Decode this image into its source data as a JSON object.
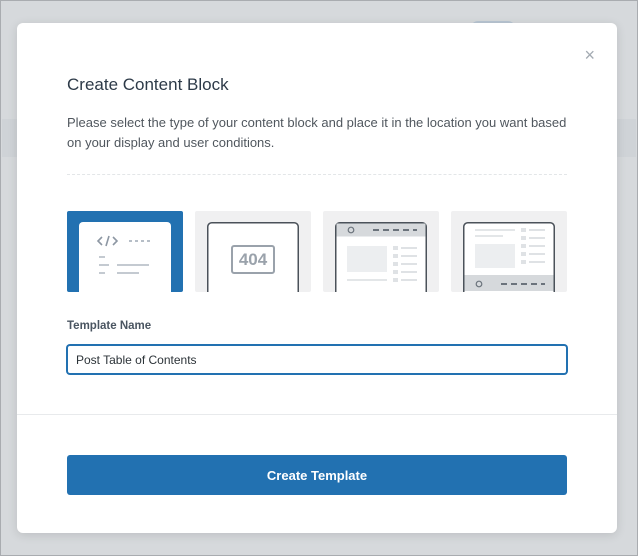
{
  "modal": {
    "title": "Create Content Block",
    "description": "Please select the type of your content block and place it in the location you want based on your display and user conditions.",
    "close_icon": "×",
    "block_types": [
      {
        "icon": "code-snippet-icon",
        "selected": true
      },
      {
        "icon": "404-page-icon",
        "selected": false,
        "icon_text": "404"
      },
      {
        "icon": "header-layout-icon",
        "selected": false
      },
      {
        "icon": "footer-layout-icon",
        "selected": false
      }
    ],
    "template_name_label": "Template Name",
    "template_name_value": "Post Table of Contents",
    "create_button_label": "Create Template"
  },
  "colors": {
    "accent": "#2271b1",
    "card_bg": "#f0f0f1",
    "title": "#2d3a48",
    "text": "#50575e"
  }
}
